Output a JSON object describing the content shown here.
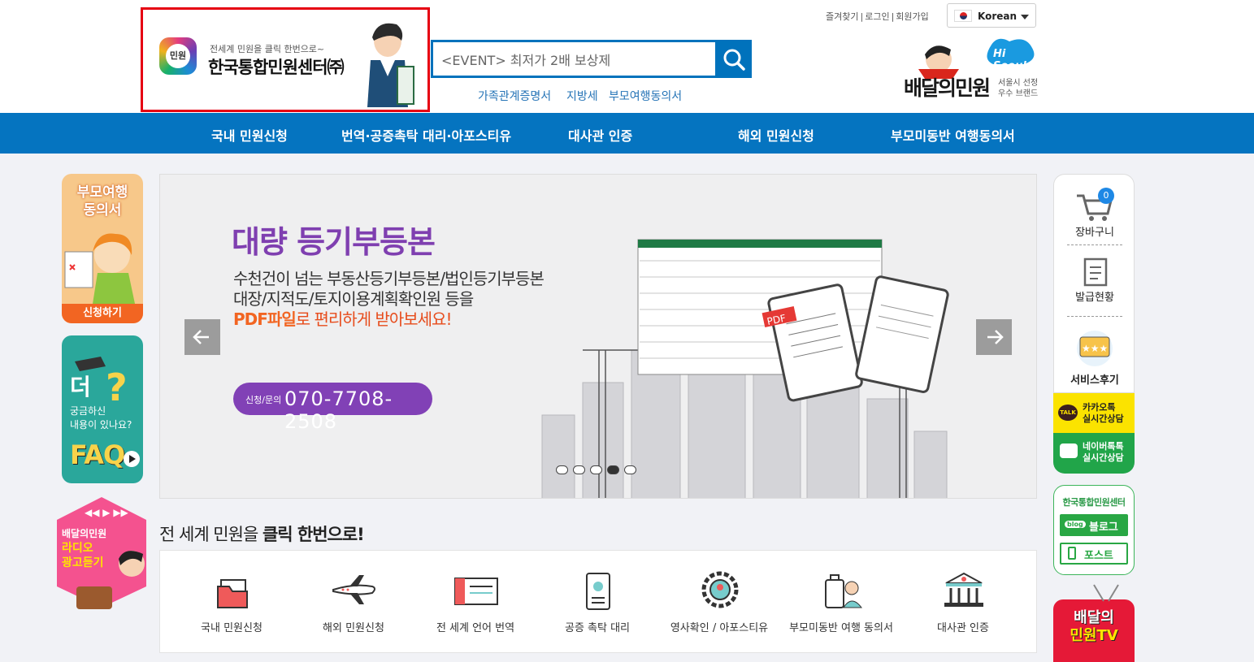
{
  "header": {
    "logo_sub": "전세계 민원을 클릭 한번으로~",
    "logo_title": "한국통합민원센터㈜",
    "logo_mark": "민원",
    "search_value": "<EVENT> 최저가 2배 보상제",
    "quick_links": [
      "가족관계증명서",
      "지방세",
      "부모여행동의서"
    ],
    "top_links": [
      "즐겨찾기",
      "로그인",
      "회원가입"
    ],
    "language": "Korean",
    "brand_name": "배달의민원",
    "brand_tag1": "서울시 선정",
    "brand_tag2": "우수 브랜드",
    "brand_hi": "Hi Seoul"
  },
  "nav": [
    "국내 민원신청",
    "번역·공증촉탁 대리·아포스티유",
    "대사관 인증",
    "해외 민원신청",
    "부모미동반 여행동의서"
  ],
  "left_banners": {
    "consent_title1": "부모여행",
    "consent_title2": "동의서",
    "consent_cta": "신청하기",
    "faq_big": "더",
    "faq_line1": "궁금하신",
    "faq_line2": "내용이 있나요?",
    "faq_label": "FAQ",
    "radio_brand": "배달의민원",
    "radio_line1": "라디오",
    "radio_line2": "광고듣기"
  },
  "slider": {
    "headline": "대량 등기부등본",
    "line1": "수천건이 넘는 부동산등기부등본/법인등기부등본",
    "line2": "대장/지적도/토지이용계획확인원 등을",
    "line3_highlight": "PDF파일",
    "line3_rest": "로 편리하게 받아보세요!",
    "contact_label": "신청/문의",
    "phone": "070-7708-2508",
    "pdf_tag": "PDF",
    "active_dot": 3,
    "dot_count": 5
  },
  "tagline_pre": "전 세계 민원을 ",
  "tagline_bold": "클릭 한번으로!",
  "services": [
    "국내 민원신청",
    "해외 민원신청",
    "전 세계 언어 번역",
    "공증 촉탁 대리",
    "영사확인 / 아포스티유",
    "부모미동반 여행 동의서",
    "대사관 인증"
  ],
  "right_side": {
    "cart_count": "0",
    "cart": "장바구니",
    "issue": "발급현황",
    "review": "서비스후기",
    "kakao_talk": "TALK",
    "kakao1": "카카오톡",
    "kakao2": "실시간상담",
    "naver1": "네이버톡톡",
    "naver2": "실시간상담",
    "sns_title": "한국통합민원센터",
    "blog": "블로그",
    "post": "포스트",
    "blog_tag": "blog",
    "tv1": "배달의",
    "tv2": "민원TV"
  },
  "colors": {
    "primary": "#0574c0",
    "logo_border": "#e60012",
    "purple": "#8141b6",
    "kakao": "#fbe300",
    "naver": "#21a549"
  }
}
